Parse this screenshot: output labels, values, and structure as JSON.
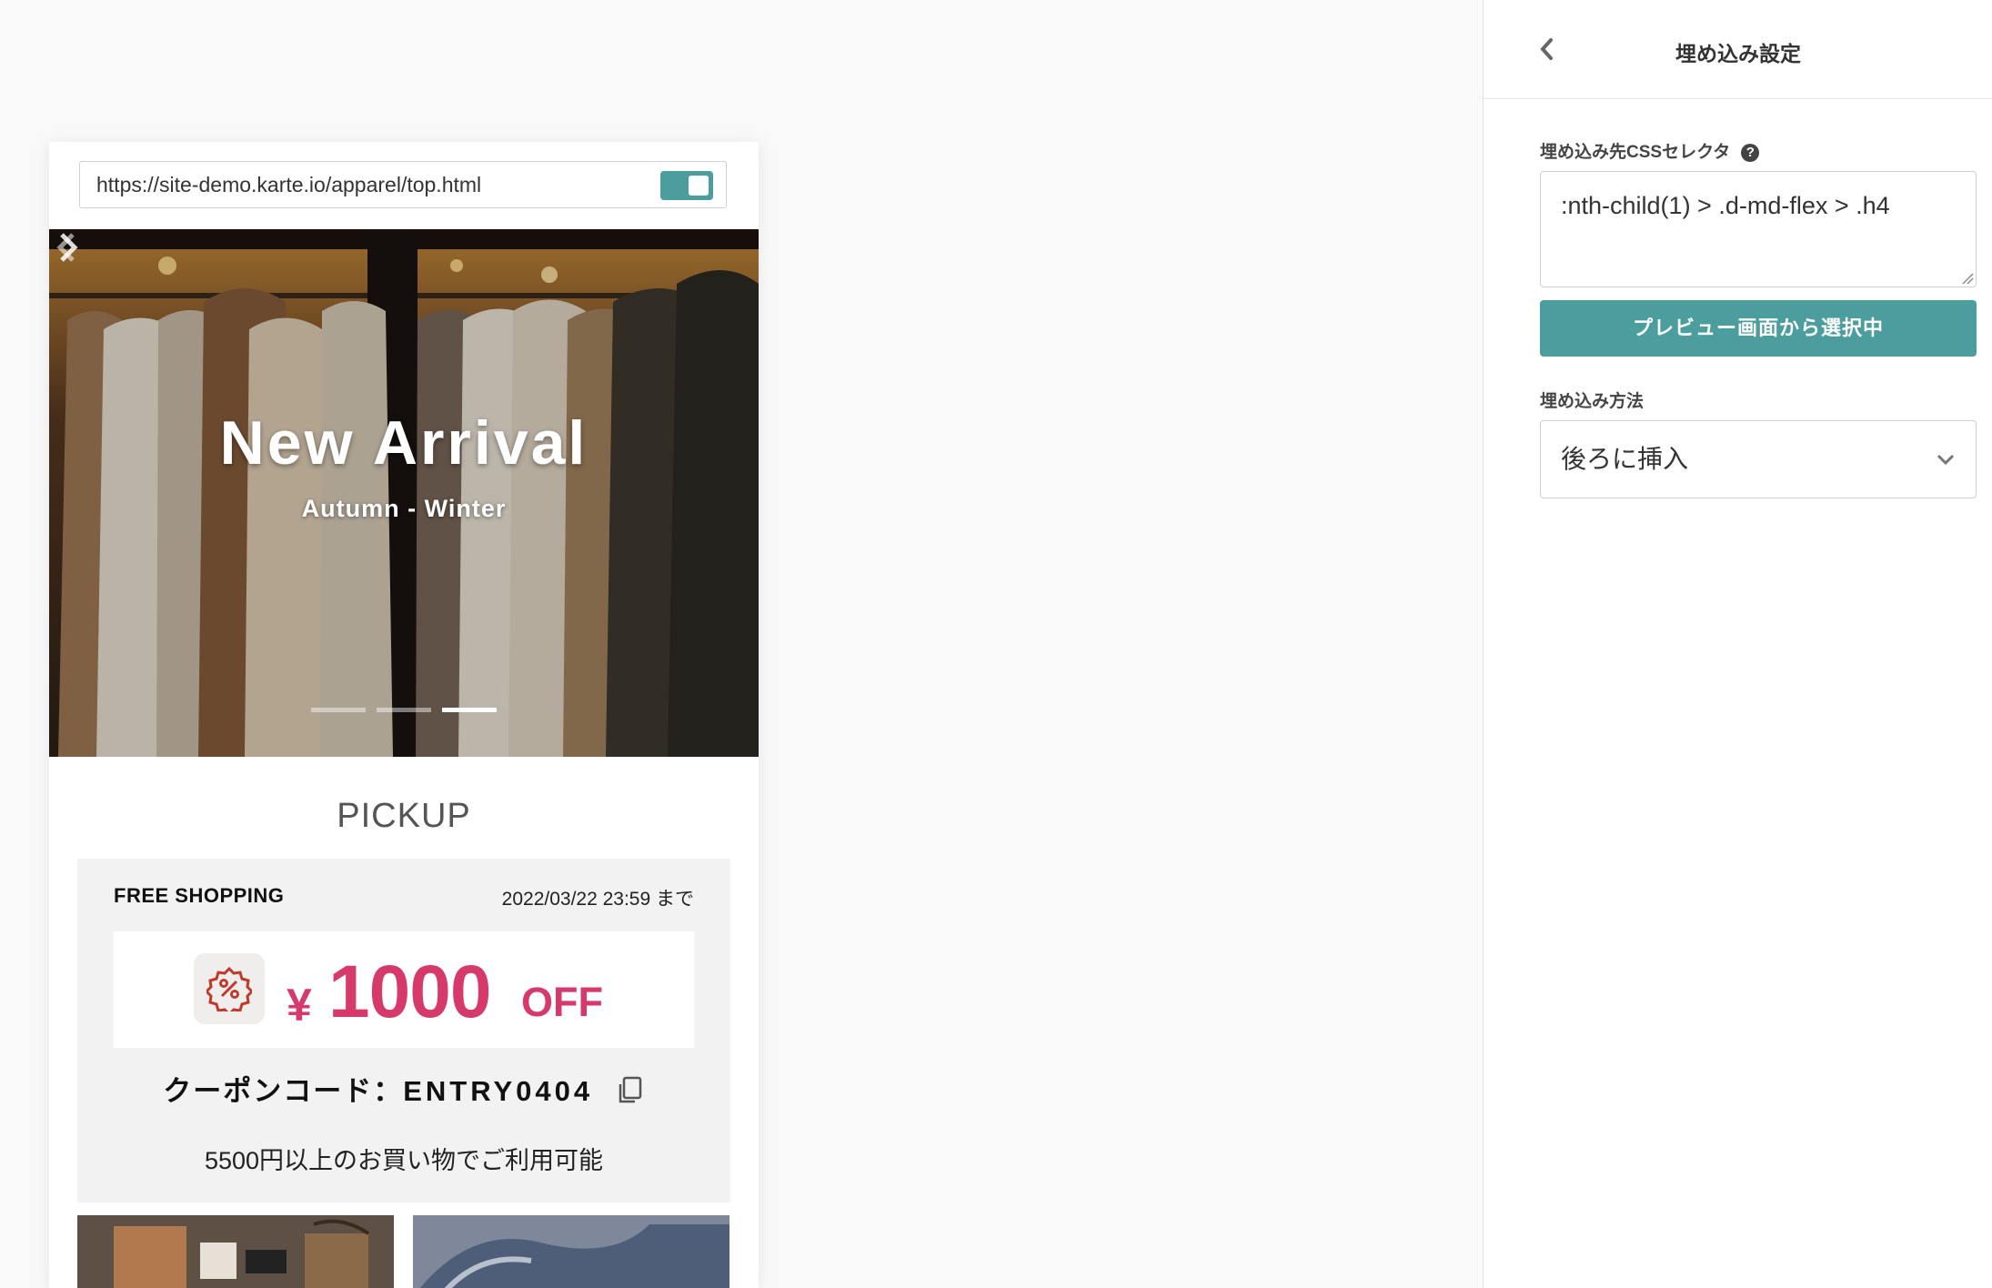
{
  "preview": {
    "url": "https://site-demo.karte.io/apparel/top.html",
    "toggle_on": true,
    "hero": {
      "title": "New Arrival",
      "subtitle": "Autumn - Winter",
      "slides_total": 3,
      "active_slide": 3
    },
    "section_title": "PICKUP",
    "coupon": {
      "label": "FREE SHOPPING",
      "deadline": "2022/03/22 23:59 まで",
      "currency": "¥",
      "amount": "1000",
      "suffix": "OFF",
      "code_label": "クーポンコード：",
      "code_value": "ENTRY0404",
      "condition": "5500円以上のお買い物でご利用可能"
    }
  },
  "panel": {
    "title": "埋め込み設定",
    "selector_label": "埋め込み先CSSセレクタ",
    "selector_value": ":nth-child(1) > .d-md-flex > .h4",
    "pick_button": "プレビュー画面から選択中",
    "method_label": "埋め込み方法",
    "method_value": "後ろに挿入"
  },
  "colors": {
    "accent": "#4b9e9d",
    "coupon_red": "#d63a6a",
    "background": "#f9f9f9"
  }
}
